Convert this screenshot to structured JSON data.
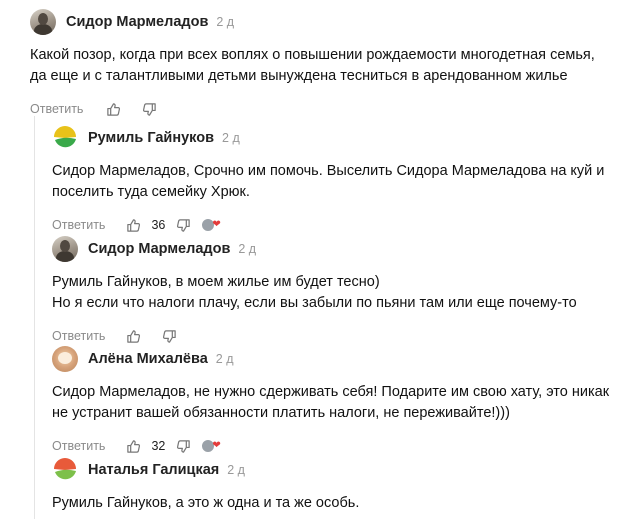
{
  "actions": {
    "reply_label": "Ответить"
  },
  "comments": [
    {
      "author": "Сидор Мармеладов",
      "time": "2 д",
      "lines": [
        "Какой позор, когда при всех воплях о повышении рождаемости многодетная семья,",
        "да еще и с талантливыми детьми вынуждена тесниться в арендованном жилье"
      ],
      "likes": null,
      "avatar_icon": "photo-avatar"
    },
    {
      "author": "Румиль Гайнуков",
      "time": "2 д",
      "lines": [
        "Сидор Мармеладов, Срочно им помочь. Выселить Сидора Мармеладова на куй и",
        "поселить туда семейку Хрюк."
      ],
      "likes": "36",
      "avatar_icon": "leaf-avatar",
      "avatar_colors": [
        "#e8c21a",
        "#3aa94a"
      ]
    },
    {
      "author": "Сидор Мармеладов",
      "time": "2 д",
      "lines": [
        "Румиль Гайнуков, в моем жилье им будет тесно)",
        "Но я если что налоги плачу, если вы забыли по пьяни там или еще почему-то"
      ],
      "likes": null,
      "avatar_icon": "photo-avatar"
    },
    {
      "author": "Алёна Михалёва",
      "time": "2 д",
      "lines": [
        "Сидор Мармеладов, не нужно сдерживать себя! Подарите им свою хату, это никак",
        "не устранит вашей обязанности платить налоги, не переживайте!)))"
      ],
      "likes": "32",
      "avatar_icon": "cat-avatar"
    },
    {
      "author": "Наталья Галицкая",
      "time": "2 д",
      "lines": [
        "Румиль Гайнуков, а это ж одна и та же особь."
      ],
      "likes": null,
      "avatar_icon": "leaf-avatar",
      "avatar_colors": [
        "#e85a3a",
        "#7dc04a"
      ]
    }
  ]
}
